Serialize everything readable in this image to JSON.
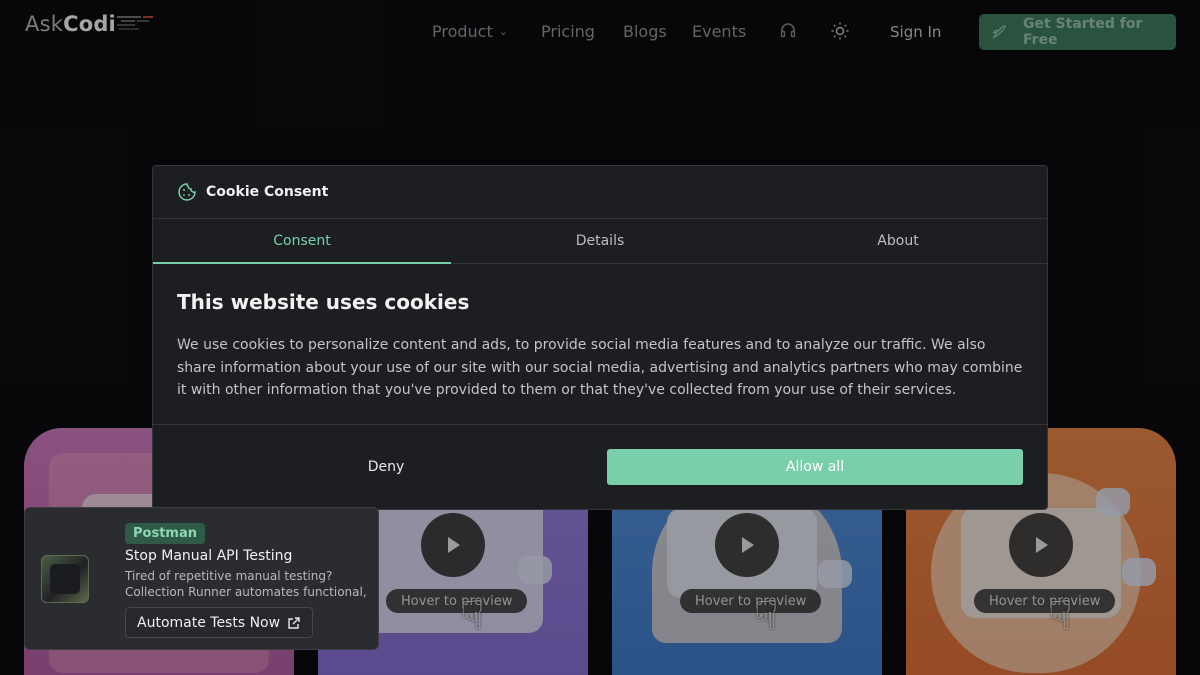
{
  "nav": {
    "logo_light": "Ask",
    "logo_bold": "Codi",
    "links": [
      "Product",
      "Pricing",
      "Blogs",
      "Events"
    ],
    "signin": "Sign In",
    "cta": "Get Started for Free",
    "icons": [
      "chevron-down-icon",
      "headset-icon",
      "sun-icon",
      "rocket-icon"
    ]
  },
  "cards": {
    "hover_label": "Hover to preview",
    "colors": [
      "#c66fb2",
      "#8b6fd6",
      "#3f7fd1",
      "#ea7a3f"
    ]
  },
  "cookie": {
    "title": "Cookie Consent",
    "tabs": [
      "Consent",
      "Details",
      "About"
    ],
    "active_tab": "Consent",
    "heading": "This website uses cookies",
    "body": "We use cookies to personalize content and ads, to provide social media features and to analyze our traffic. We also share information about your use of our site with our social media, advertising and analytics partners who may combine it with other information that you've provided to them or that they've collected from your use of their services.",
    "deny": "Deny",
    "allow": "Allow all",
    "accent": "#78cfaa"
  },
  "ad": {
    "tag": "Postman",
    "title": "Stop Manual API Testing",
    "desc_line1": "Tired of repetitive manual testing?",
    "desc_line2": "Collection Runner automates functional,",
    "button": "Automate Tests Now"
  }
}
